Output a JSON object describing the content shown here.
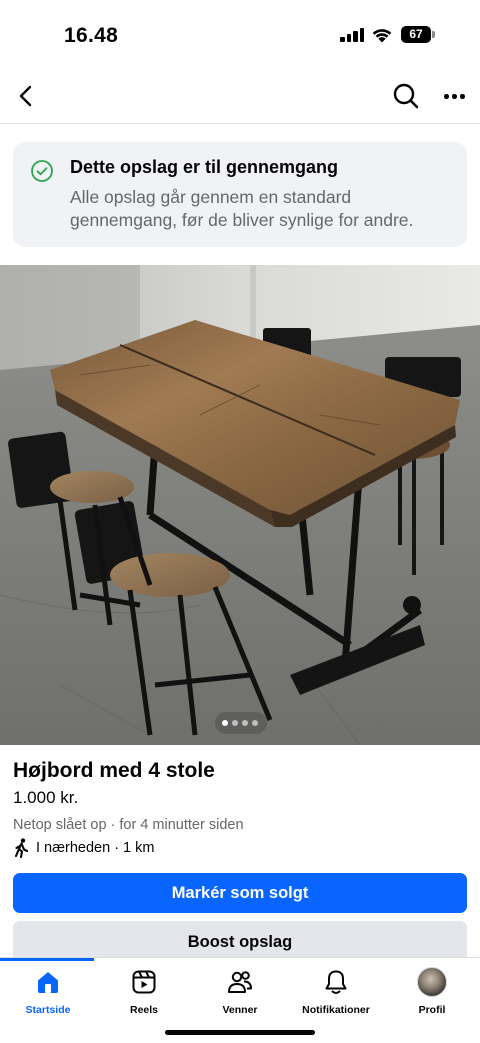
{
  "status_bar": {
    "time": "16.48",
    "battery": "67"
  },
  "nav": {
    "back_icon": "chevron-left-icon",
    "search_icon": "search-icon",
    "more_icon": "more-horizontal-icon"
  },
  "review_notice": {
    "icon": "check-circle-icon",
    "title": "Dette opslag er til gennemgang",
    "body": "Alle opslag går gennem en standard gennemgang, før de bliver synlige for andre."
  },
  "photo": {
    "description": "wooden-table-with-4-stools",
    "current_index": 1,
    "total": 4
  },
  "listing": {
    "title": "Højbord med 4 stole",
    "price": "1.000 kr.",
    "meta": "Netop slået op · for 4 minutter siden",
    "distance": "I nærheden · 1 km"
  },
  "actions": {
    "mark_sold": "Markér som solgt",
    "boost": "Boost opslag"
  },
  "tabs": [
    {
      "label": "Startside",
      "icon": "home-icon",
      "active": true
    },
    {
      "label": "Reels",
      "icon": "reels-icon",
      "active": false
    },
    {
      "label": "Venner",
      "icon": "friends-icon",
      "active": false
    },
    {
      "label": "Notifikationer",
      "icon": "bell-icon",
      "active": false
    },
    {
      "label": "Profil",
      "icon": "avatar",
      "active": false
    }
  ],
  "colors": {
    "accent": "#0866ff",
    "review_green": "#2ea44f",
    "notice_bg": "#f0f2f5"
  }
}
